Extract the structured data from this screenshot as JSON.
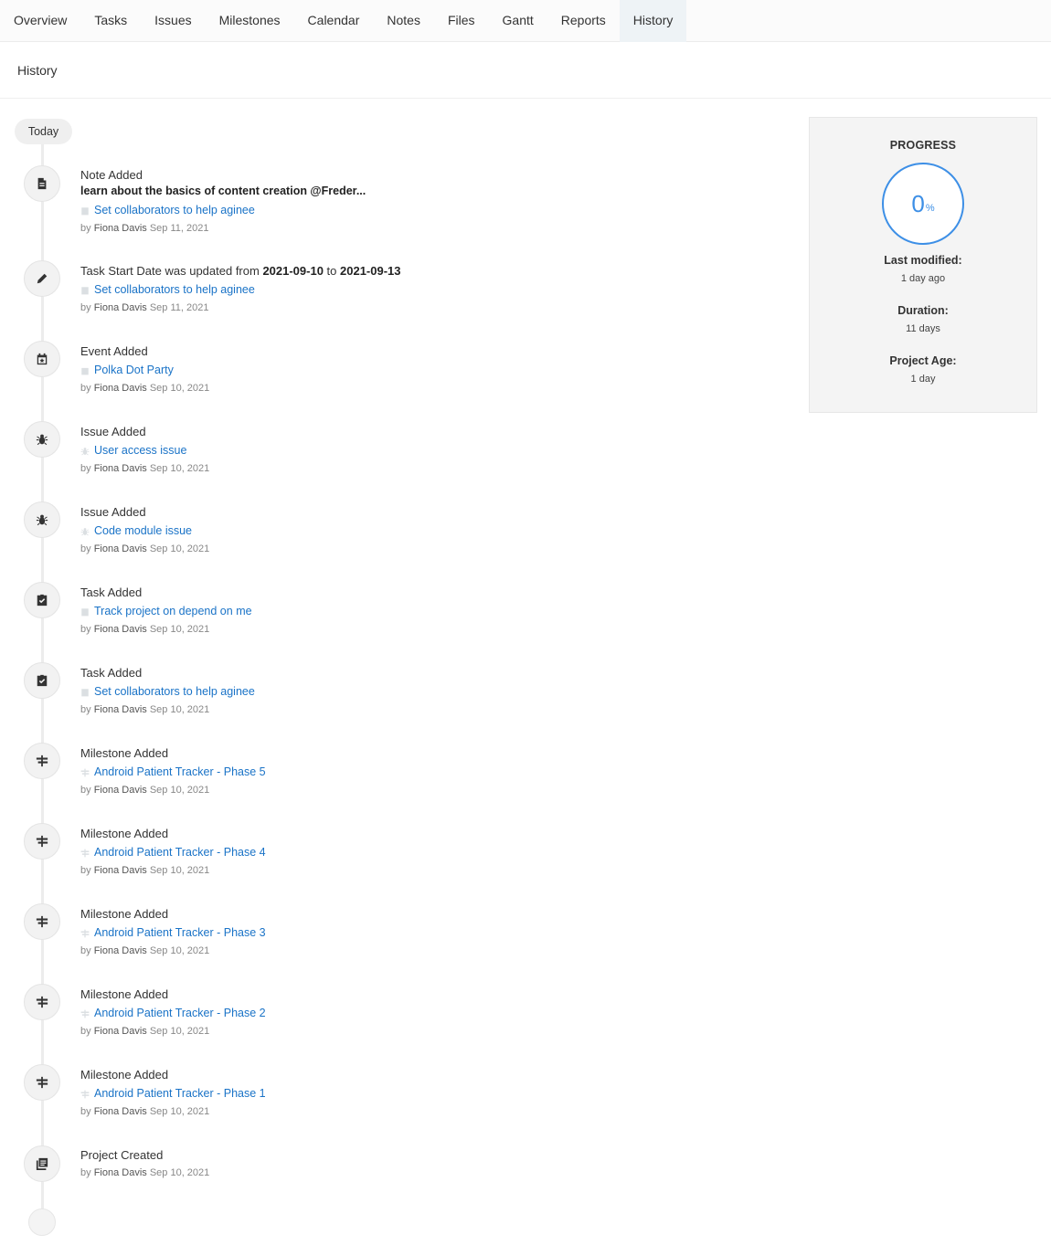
{
  "tabs": [
    {
      "label": "Overview",
      "active": false
    },
    {
      "label": "Tasks",
      "active": false
    },
    {
      "label": "Issues",
      "active": false
    },
    {
      "label": "Milestones",
      "active": false
    },
    {
      "label": "Calendar",
      "active": false
    },
    {
      "label": "Notes",
      "active": false
    },
    {
      "label": "Files",
      "active": false
    },
    {
      "label": "Gantt",
      "active": false
    },
    {
      "label": "Reports",
      "active": false
    },
    {
      "label": "History",
      "active": true
    }
  ],
  "page": {
    "title": "History",
    "group_label": "Today"
  },
  "events": [
    {
      "icon": "note-icon",
      "title": "Note Added",
      "desc": "learn about the basics of content creation @Freder...",
      "link": "Set collaborators to help aginee",
      "link_icon": "task-icon",
      "by": "by",
      "user": "Fiona Davis",
      "date": "Sep 11, 2021"
    },
    {
      "icon": "pencil-icon",
      "title_parts": [
        "Task Start Date was updated from ",
        "2021-09-10",
        " to ",
        "2021-09-13"
      ],
      "link": "Set collaborators to help aginee",
      "link_icon": "task-icon",
      "by": "by",
      "user": "Fiona Davis",
      "date": "Sep 11, 2021"
    },
    {
      "icon": "calendar-event-icon",
      "title": "Event Added",
      "link": "Polka Dot Party",
      "link_icon": "calendar-icon",
      "by": "by",
      "user": "Fiona Davis",
      "date": "Sep 10, 2021"
    },
    {
      "icon": "bug-icon",
      "title": "Issue Added",
      "link": "User access issue",
      "link_icon": "bug-icon",
      "by": "by",
      "user": "Fiona Davis",
      "date": "Sep 10, 2021"
    },
    {
      "icon": "bug-icon",
      "title": "Issue Added",
      "link": "Code module issue",
      "link_icon": "bug-icon",
      "by": "by",
      "user": "Fiona Davis",
      "date": "Sep 10, 2021"
    },
    {
      "icon": "task-check-icon",
      "title": "Task Added",
      "link": "Track project on depend on me",
      "link_icon": "task-icon",
      "by": "by",
      "user": "Fiona Davis",
      "date": "Sep 10, 2021"
    },
    {
      "icon": "task-check-icon",
      "title": "Task Added",
      "link": "Set collaborators to help aginee",
      "link_icon": "task-icon",
      "by": "by",
      "user": "Fiona Davis",
      "date": "Sep 10, 2021"
    },
    {
      "icon": "milestone-icon",
      "title": "Milestone Added",
      "link": "Android Patient Tracker - Phase 5",
      "link_icon": "milestone-icon",
      "by": "by",
      "user": "Fiona Davis",
      "date": "Sep 10, 2021"
    },
    {
      "icon": "milestone-icon",
      "title": "Milestone Added",
      "link": "Android Patient Tracker - Phase 4",
      "link_icon": "milestone-icon",
      "by": "by",
      "user": "Fiona Davis",
      "date": "Sep 10, 2021"
    },
    {
      "icon": "milestone-icon",
      "title": "Milestone Added",
      "link": "Android Patient Tracker - Phase 3",
      "link_icon": "milestone-icon",
      "by": "by",
      "user": "Fiona Davis",
      "date": "Sep 10, 2021"
    },
    {
      "icon": "milestone-icon",
      "title": "Milestone Added",
      "link": "Android Patient Tracker - Phase 2",
      "link_icon": "milestone-icon",
      "by": "by",
      "user": "Fiona Davis",
      "date": "Sep 10, 2021"
    },
    {
      "icon": "milestone-icon",
      "title": "Milestone Added",
      "link": "Android Patient Tracker - Phase 1",
      "link_icon": "milestone-icon",
      "by": "by",
      "user": "Fiona Davis",
      "date": "Sep 10, 2021"
    },
    {
      "icon": "project-icon",
      "title": "Project Created",
      "by": "by",
      "user": "Fiona Davis",
      "date": "Sep 10, 2021"
    }
  ],
  "progress": {
    "heading": "PROGRESS",
    "value": "0",
    "unit": "%",
    "percent": 0,
    "accent_color": "#3d8fe6",
    "last_modified_label": "Last modified:",
    "last_modified": "1 day ago",
    "duration_label": "Duration:",
    "duration": "11 days",
    "age_label": "Project Age:",
    "age": "1 day"
  }
}
